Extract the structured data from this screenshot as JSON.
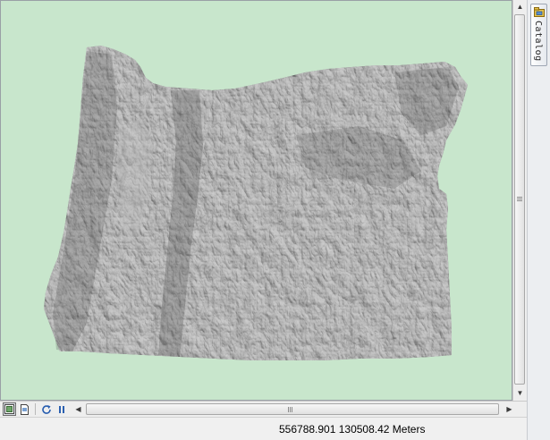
{
  "colors": {
    "map_background": "#c8e6cc",
    "terrain_fill": "#868686",
    "terrain_dark": "#3f3f3f",
    "terrain_light": "#cfcfcf"
  },
  "map": {
    "layer_description": "Oregon hillshade relief raster"
  },
  "side_panel": {
    "catalog_label": "Catalog",
    "catalog_icon": "catalog-window-icon"
  },
  "toolbar": {
    "data_view_icon": "data-view-icon",
    "layout_view_icon": "layout-view-icon",
    "refresh_icon": "refresh-icon",
    "pause_icon": "pause-drawing-icon"
  },
  "status": {
    "coordinates": "556788.901  130508.42 Meters"
  }
}
